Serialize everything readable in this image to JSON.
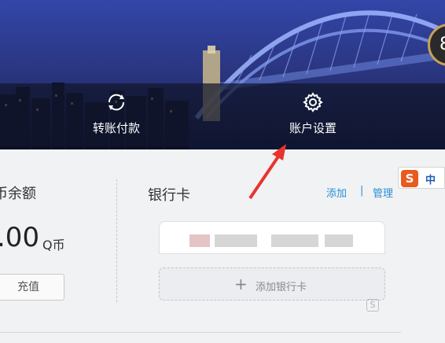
{
  "nav": {
    "transfer_label": "转账付款",
    "settings_label": "账户设置"
  },
  "avatar": {
    "text": "8"
  },
  "qcoin": {
    "title": "币余额",
    "amount": ".00",
    "unit": "Q币",
    "recharge_label": "充值"
  },
  "bank": {
    "title": "银行卡",
    "add_link": "添加",
    "separator": "|",
    "manage_link": "管理",
    "add_card_plus": "+",
    "add_card_label": "添加银行卡"
  },
  "ime": {
    "logo": "S",
    "mode": "中"
  },
  "watermark": {
    "text": "S"
  },
  "colors": {
    "link": "#2a8fd4",
    "arrow": "#e8342e",
    "banner_overlay": "#10162c"
  }
}
